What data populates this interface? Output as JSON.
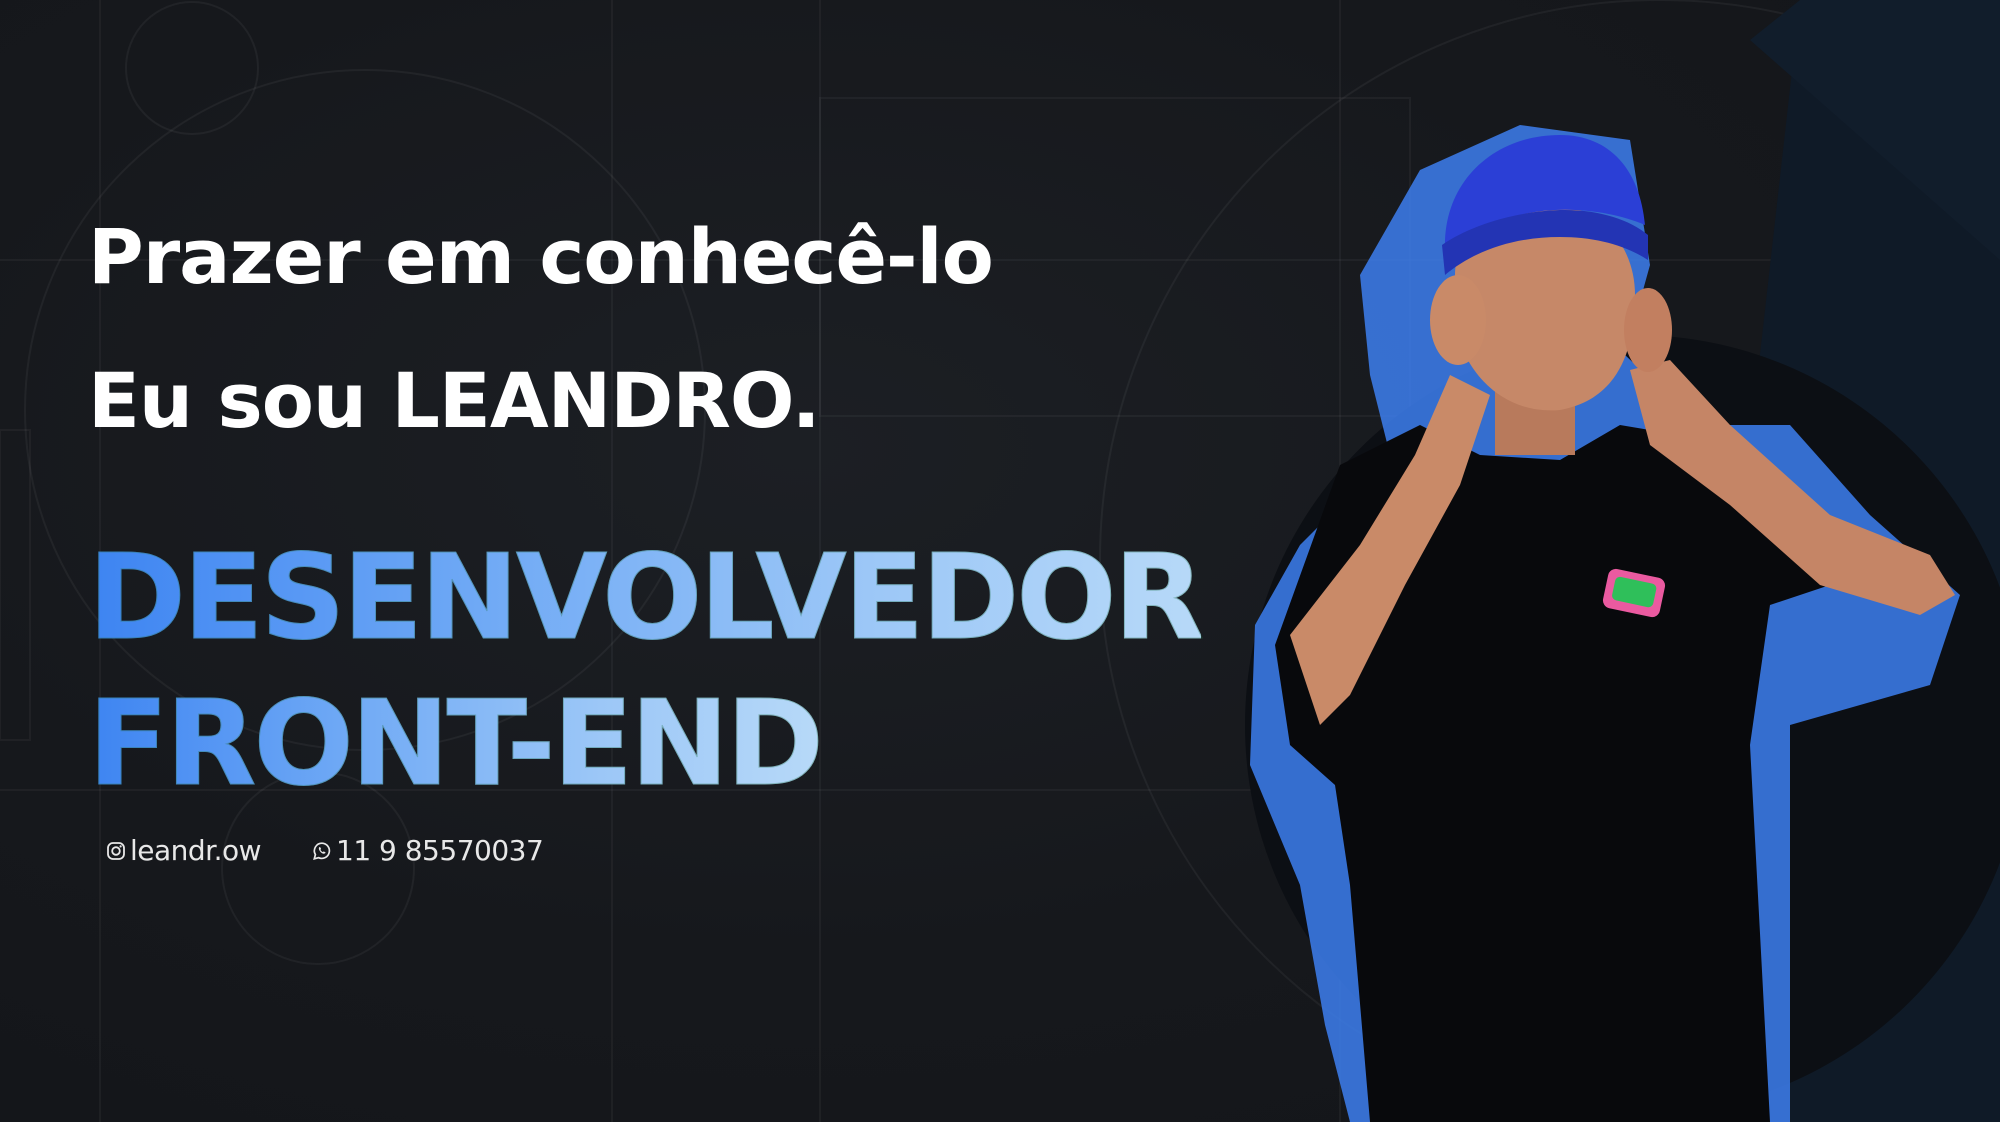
{
  "hero": {
    "greeting": "Prazer em conhecê-lo",
    "intro": "Eu sou LEANDRO.",
    "role_line1": "DESENVOLVEDOR",
    "role_line2": "FRONT-END"
  },
  "contacts": {
    "instagram": {
      "icon": "instagram-icon",
      "text": "leandr.ow"
    },
    "whatsapp": {
      "icon": "whatsapp-icon",
      "text": "11 9 85570037"
    }
  },
  "colors": {
    "background": "#16181c",
    "headline": "#ffffff",
    "gradient_start": "#3d84f2",
    "gradient_end": "#b7d9f8",
    "accent_panel": "#0f1a27",
    "photo_outline": "#3d7ff0",
    "beanie": "#2b3fd6"
  }
}
